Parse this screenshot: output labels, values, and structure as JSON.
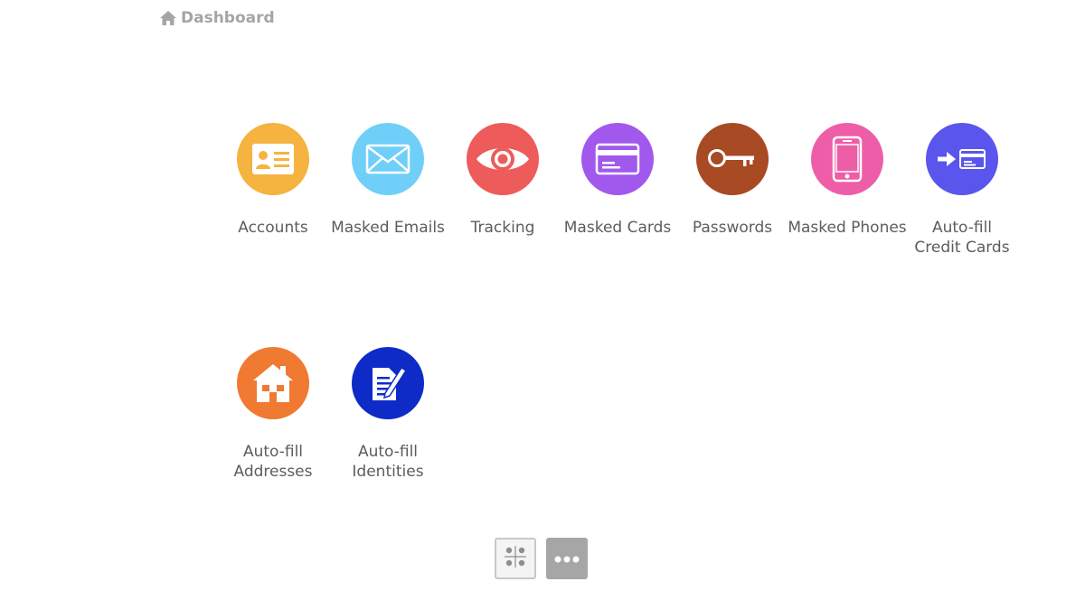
{
  "breadcrumb": {
    "icon": "home-icon",
    "label": "Dashboard",
    "color": "#a3a6a8"
  },
  "tiles": [
    {
      "label": "Accounts",
      "icon": "id-card-icon",
      "color": "#f5b33f"
    },
    {
      "label": "Masked Emails",
      "icon": "envelope-icon",
      "color": "#6fcff8"
    },
    {
      "label": "Tracking",
      "icon": "eye-icon",
      "color": "#ee5b5b"
    },
    {
      "label": "Masked Cards",
      "icon": "credit-card-icon",
      "color": "#a158ec"
    },
    {
      "label": "Passwords",
      "icon": "key-icon",
      "color": "#a84a24"
    },
    {
      "label": "Masked Phones",
      "icon": "phone-icon",
      "color": "#ee5ea8"
    },
    {
      "label": "Auto-fill\nCredit Cards",
      "icon": "autofill-card-icon",
      "color": "#5a55ec"
    },
    {
      "label": "Auto-fill\nAddresses",
      "icon": "house-icon",
      "color": "#f07a32"
    },
    {
      "label": "Auto-fill\nIdentities",
      "icon": "form-pen-icon",
      "color": "#0e2bc8"
    }
  ],
  "view_controls": {
    "grid_icon": "grid-view-icon",
    "more_icon": "more-dots-icon"
  }
}
